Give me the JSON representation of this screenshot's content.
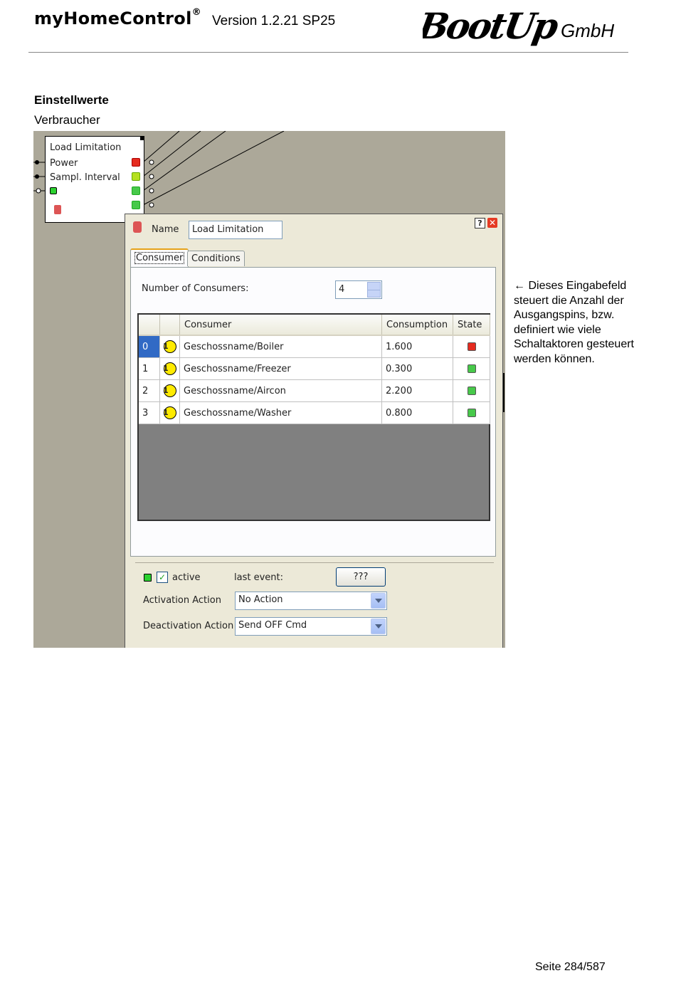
{
  "header": {
    "app_name": "myHomeControl",
    "registered_mark": "®",
    "version": "Version 1.2.21 SP25",
    "logo_text": "BootUp",
    "logo_suffix": "GmbH"
  },
  "section_title": "Einstellwerte",
  "section_subtitle": "Verbraucher",
  "block": {
    "title": "Load Limitation",
    "inputs": [
      "Power",
      "Sampl. Interval"
    ]
  },
  "dialog": {
    "name_label": "Name",
    "name_value": "Load Limitation",
    "tabs": [
      "Consumer",
      "Conditions"
    ],
    "num_consumers_label": "Number of Consumers:",
    "num_consumers_value": "4",
    "columns": [
      "Consumer",
      "Consumption",
      "State"
    ],
    "rows": [
      {
        "index": "0",
        "consumer": "Geschossname/Boiler",
        "consumption": "1.600",
        "state_color": "#e52b1f"
      },
      {
        "index": "1",
        "consumer": "Geschossname/Freezer",
        "consumption": "0.300",
        "state_color": "#47c94a"
      },
      {
        "index": "2",
        "consumer": "Geschossname/Aircon",
        "consumption": "2.200",
        "state_color": "#47c94a"
      },
      {
        "index": "3",
        "consumer": "Geschossname/Washer",
        "consumption": "0.800",
        "state_color": "#47c94a"
      }
    ],
    "active_label": "active",
    "last_event_label": "last event:",
    "last_event_button": "???",
    "activation_label": "Activation Action",
    "activation_value": "No Action",
    "deactivation_label": "Deactivation Action",
    "deactivation_value": "Send OFF Cmd"
  },
  "note": {
    "arrow": "←",
    "text": "Dieses Eingabefeld steuert die Anzahl der Ausgangspins, bzw. definiert wie viele Schaltaktoren gesteuert werden können."
  },
  "footer": {
    "page": "Seite 284/587"
  }
}
